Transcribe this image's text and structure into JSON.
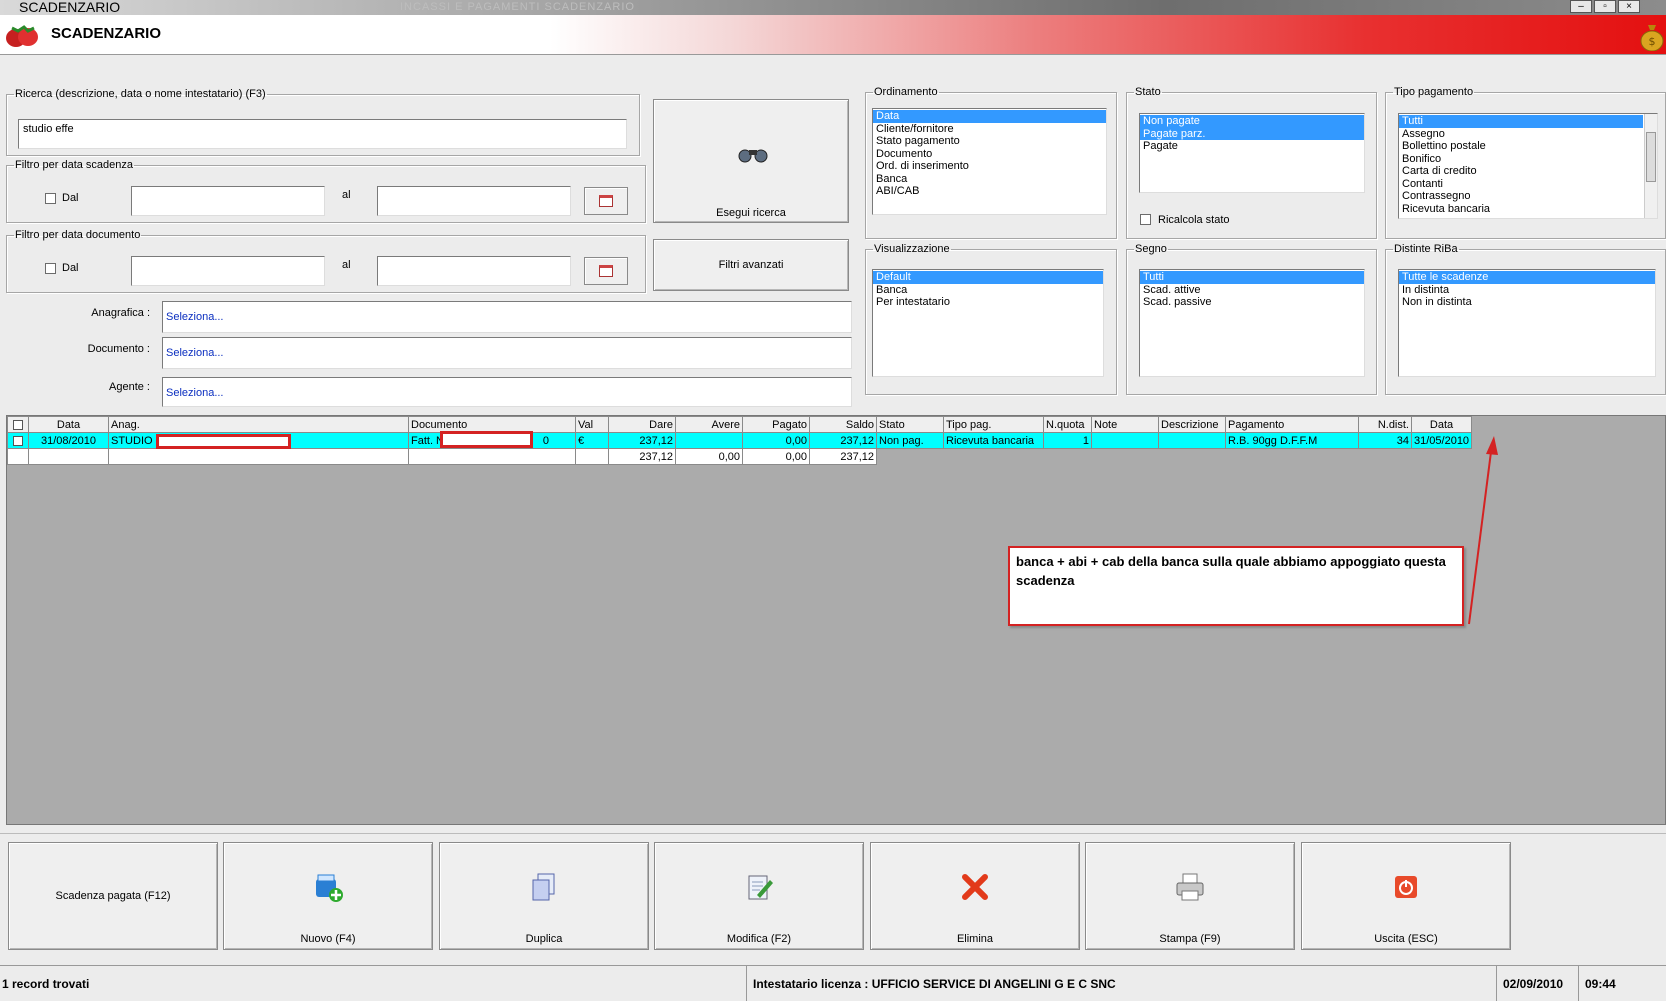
{
  "window": {
    "title": "SCADENZARIO",
    "ghost_title": "INCASSI E PAGAMENTI      SCADENZARIO"
  },
  "header": {
    "title": "SCADENZARIO"
  },
  "search": {
    "group_label": "Ricerca (descrizione, data o nome intestatario) (F3)",
    "value": "studio effe",
    "exec_button": "Esegui ricerca",
    "advanced_button": "Filtri avanzati"
  },
  "filter_due": {
    "group_label": "Filtro per data scadenza",
    "dal_label": "Dal",
    "al_label": "al",
    "from": "",
    "to": ""
  },
  "filter_doc": {
    "group_label": "Filtro per data documento",
    "dal_label": "Dal",
    "al_label": "al",
    "from": "",
    "to": ""
  },
  "pickers": [
    {
      "label": "Anagrafica :",
      "value": "Seleziona..."
    },
    {
      "label": "Documento :",
      "value": "Seleziona..."
    },
    {
      "label": "Agente :",
      "value": "Seleziona..."
    }
  ],
  "ordinamento": {
    "label": "Ordinamento",
    "items": [
      "Data",
      "Cliente/fornitore",
      "Stato pagamento",
      "Documento",
      "Ord. di inserimento",
      "Banca",
      "ABI/CAB"
    ],
    "selected": [
      0
    ]
  },
  "stato": {
    "label": "Stato",
    "items": [
      "Non pagate",
      "Pagate parz.",
      "Pagate"
    ],
    "selected": [
      0,
      1
    ],
    "recalc_label": "Ricalcola stato"
  },
  "tipo_pagamento": {
    "label": "Tipo pagamento",
    "items": [
      "Tutti",
      "Assegno",
      "Bollettino postale",
      "Bonifico",
      "Carta di credito",
      "Contanti",
      "Contrassegno",
      "Ricevuta bancaria"
    ],
    "selected": [
      0
    ]
  },
  "visualizzazione": {
    "label": "Visualizzazione",
    "items": [
      "Default",
      "Banca",
      "Per intestatario"
    ],
    "selected": [
      0
    ]
  },
  "segno": {
    "label": "Segno",
    "items": [
      "Tutti",
      "Scad. attive",
      "Scad. passive"
    ],
    "selected": [
      0
    ]
  },
  "distinte": {
    "label": "Distinte RiBa",
    "items": [
      "Tutte le scadenze",
      "In distinta",
      "Non in distinta"
    ],
    "selected": [
      0
    ]
  },
  "grid": {
    "columns": [
      "Data",
      "Anag.",
      "Documento",
      "Val",
      "Dare",
      "Avere",
      "Pagato",
      "Saldo",
      "Stato",
      "Tipo pag.",
      "N.quota",
      "Note",
      "Descrizione",
      "Pagamento",
      "N.dist.",
      "Data"
    ],
    "row": {
      "data": "31/08/2010",
      "anag": "STUDIO",
      "documento": "Fatt. N",
      "doc_tail": "0",
      "val": "€",
      "dare": "237,12",
      "avere": "",
      "pagato": "0,00",
      "saldo": "237,12",
      "stato": "Non pag.",
      "tipo_pag": "Ricevuta bancaria",
      "n_quota": "1",
      "note": "",
      "descrizione": "",
      "pagamento": "R.B. 90gg D.F.F.M",
      "n_dist": "34",
      "data2": "31/05/2010"
    },
    "totals": {
      "dare": "237,12",
      "avere": "0,00",
      "pagato": "0,00",
      "saldo": "237,12"
    }
  },
  "annotation": {
    "text": "banca + abi + cab della banca sulla quale abbiamo appoggiato questa scadenza",
    "color": "#d42222"
  },
  "buttons": {
    "paid": "Scadenza pagata (F12)",
    "new": "Nuovo (F4)",
    "dup": "Duplica",
    "edit": "Modifica (F2)",
    "del": "Elimina",
    "print": "Stampa (F9)",
    "exit": "Uscita (ESC)"
  },
  "status": {
    "records": "1 record trovati",
    "license": "Intestatario licenza : UFFICIO SERVICE DI ANGELINI G E C SNC",
    "date": "02/09/2010",
    "time": "09:44"
  },
  "colors": {
    "selection": "#3399ff",
    "row_highlight": "#00ffff",
    "header_red": "#e41010"
  }
}
